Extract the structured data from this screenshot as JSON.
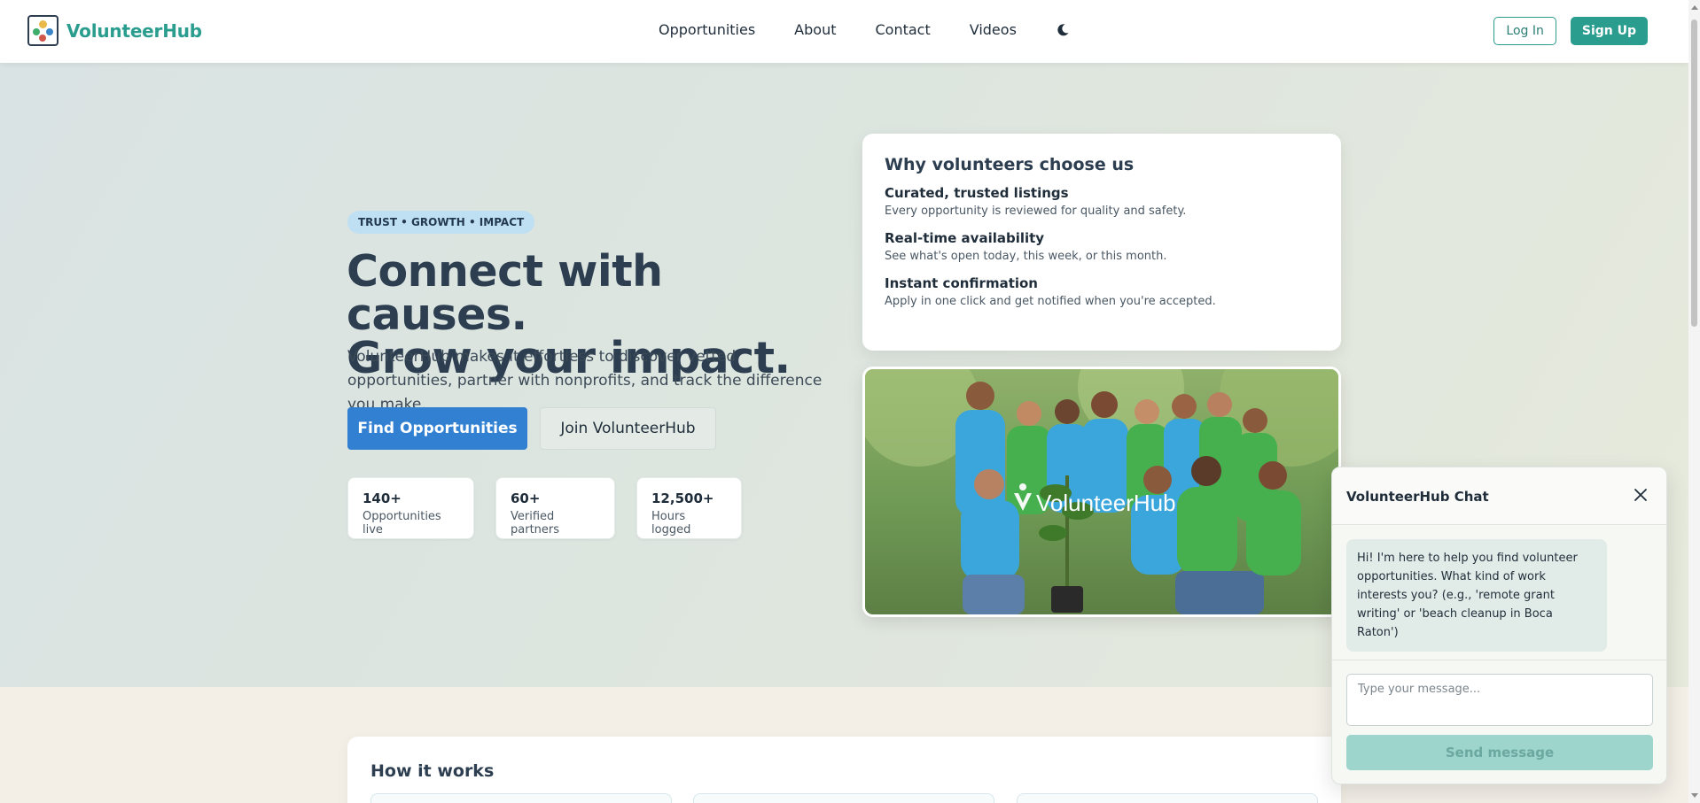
{
  "header": {
    "brand_name": "VolunteerHub",
    "nav": {
      "opportunities": "Opportunities",
      "about": "About",
      "contact": "Contact",
      "videos": "Videos"
    },
    "login_label": "Log In",
    "signup_label": "Sign Up"
  },
  "hero": {
    "pill": "TRUST • GROWTH • IMPACT",
    "title_line1": "Connect with causes.",
    "title_line2": "Grow your impact.",
    "subtitle": "VolunteerHub makes it effortless to discover vetted opportunities, partner with nonprofits, and track the difference you make.",
    "primary_cta": "Find Opportunities",
    "secondary_cta": "Join VolunteerHub",
    "stats": [
      {
        "value": "140+",
        "label": "Opportunities live"
      },
      {
        "value": "60+",
        "label": "Verified partners"
      },
      {
        "value": "12,500+",
        "label": "Hours logged"
      }
    ]
  },
  "why": {
    "title": "Why volunteers choose us",
    "items": [
      {
        "title": "Curated, trusted listings",
        "text": "Every opportunity is reviewed for quality and safety."
      },
      {
        "title": "Real-time availability",
        "text": "See what's open today, this week, or this month."
      },
      {
        "title": "Instant confirmation",
        "text": "Apply in one click and get notified when you're accepted."
      }
    ]
  },
  "photo": {
    "watermark": "VolunteerHub"
  },
  "how": {
    "title": "How it works"
  },
  "chat": {
    "title": "VolunteerHub Chat",
    "greeting": "Hi! I'm here to help you find volunteer opportunities. What kind of work interests you? (e.g., 'remote grant writing' or 'beach cleanup in Boca Raton')",
    "input_placeholder": "Type your message...",
    "send_label": "Send message"
  },
  "colors": {
    "brand": "#2a9d8f",
    "primary": "#3180d2",
    "text": "#2c3e50"
  }
}
